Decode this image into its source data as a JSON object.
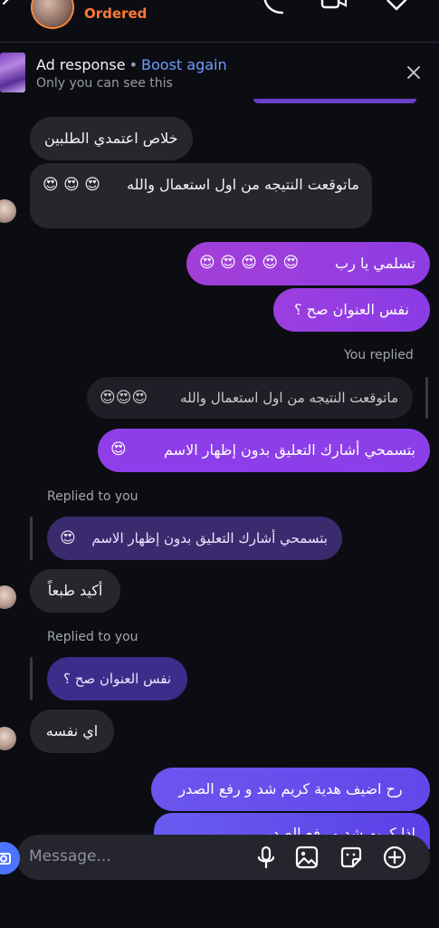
{
  "header": {
    "status": "Ordered"
  },
  "ad": {
    "title": "Ad response",
    "separator": "•",
    "boost": "Boost again",
    "subtitle": "Only you can see this"
  },
  "messages": {
    "m1": "خلاص اعتمدي الطلبين",
    "m2_text": "ماتوقعت النتيجه من اول استعمال والله",
    "m2_emoji": "😍 😍 😍",
    "m3_text": "تسلمي يا رب",
    "m3_emoji": "😍 😍 😍 😍 😍",
    "m4": "نفس العنوان صح ؟",
    "you_replied": "You replied",
    "quote1_text": "ماتوقعت النتيجه من اول استعمال والله",
    "quote1_emoji": "😍😍😍",
    "m5_text": "بتسمحي أشارك التعليق بدون إظهار الاسم",
    "m5_emoji": "😍",
    "replied_to_you_1": "Replied to you",
    "quote2_text": "بتسمحي أشارك التعليق بدون إظهار الاسم",
    "quote2_emoji": "😍",
    "m6": "أكيد طبعاً",
    "replied_to_you_2": "Replied to you",
    "quote3": "نفس العنوان صح ؟",
    "m7": "اي نفسه",
    "m8": "رح اضيف هدية كريم شد و رفع الصدر",
    "m9_partial": "اذا كريم شد و رفع الصدر"
  },
  "composer": {
    "placeholder": "Message..."
  },
  "colors": {
    "accent_orange": "#ff7a35",
    "link_blue": "#6f9dff",
    "outgoing_purple": "#8d3ce0",
    "incoming_gray": "#26272d"
  }
}
